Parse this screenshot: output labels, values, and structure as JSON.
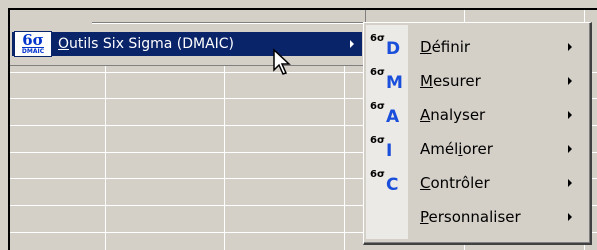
{
  "parent_menu": {
    "app_icon_big": "6σ",
    "app_icon_small": "DMAIC",
    "item_label_prefix": "O",
    "item_label_rest": "utils Six Sigma (DMAIC)"
  },
  "submenu": {
    "items": [
      {
        "icon_six": "6σ",
        "icon_letter": "D",
        "label_ul": "D",
        "label_rest": "éfinir",
        "icon": "dmaic-define-icon"
      },
      {
        "icon_six": "6σ",
        "icon_letter": "M",
        "label_ul": "M",
        "label_rest": "esurer",
        "icon": "dmaic-measure-icon"
      },
      {
        "icon_six": "6σ",
        "icon_letter": "A",
        "label_ul": "A",
        "label_rest": "nalyser",
        "icon": "dmaic-analyse-icon"
      },
      {
        "icon_six": "6σ",
        "icon_letter": "I",
        "label_pre": "Amél",
        "label_ul": "i",
        "label_rest": "orer",
        "icon": "dmaic-improve-icon"
      },
      {
        "icon_six": "6σ",
        "icon_letter": "C",
        "label_ul": "C",
        "label_rest": "ontrôler",
        "icon": "dmaic-control-icon"
      },
      {
        "label_ul": "P",
        "label_rest": "ersonnaliser"
      }
    ]
  },
  "colors": {
    "menu_bg": "#d4d0c8",
    "highlight": "#0a246a",
    "icon_blue": "#1a4fdc"
  }
}
